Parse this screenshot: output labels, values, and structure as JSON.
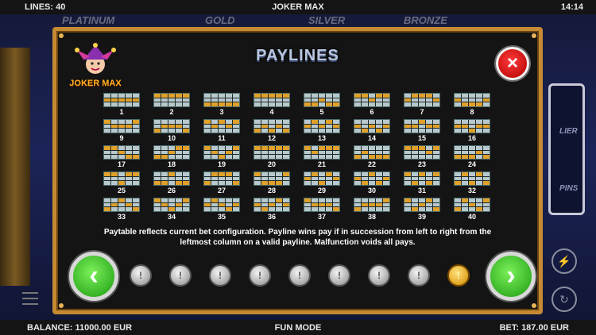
{
  "top_bar": {
    "lines": "LINES: 40",
    "title": "JOKER MAX",
    "time": "14:14"
  },
  "background": {
    "tiers": [
      "PLATINUM",
      "GOLD",
      "SILVER",
      "BRONZE"
    ],
    "right_panel_words": [
      "LIER",
      "PINS"
    ]
  },
  "panel": {
    "title": "PAYLINES",
    "logo_text": "JOKER MAX",
    "close_icon": "×",
    "info_text": "Paytable reflects current bet configuration.  Payline wins pay if in succession from left to right from the leftmost column on a valid payline.  Malfunction voids all pays.",
    "nav": {
      "prev_icon": "‹",
      "next_icon": "›"
    },
    "page_indicator": {
      "total": 9,
      "active_index": 8
    },
    "paylines": [
      {
        "n": "1",
        "rows": [
          1,
          1,
          1,
          1,
          1
        ]
      },
      {
        "n": "2",
        "rows": [
          0,
          0,
          0,
          0,
          0
        ]
      },
      {
        "n": "3",
        "rows": [
          2,
          2,
          2,
          2,
          2
        ]
      },
      {
        "n": "4",
        "rows": [
          0,
          0,
          0,
          0,
          0
        ]
      },
      {
        "n": "5",
        "rows": [
          2,
          2,
          1,
          2,
          2
        ]
      },
      {
        "n": "6",
        "rows": [
          0,
          0,
          1,
          0,
          0
        ]
      },
      {
        "n": "7",
        "rows": [
          1,
          0,
          0,
          0,
          1
        ]
      },
      {
        "n": "8",
        "rows": [
          1,
          2,
          2,
          2,
          1
        ]
      },
      {
        "n": "9",
        "rows": [
          0,
          1,
          1,
          1,
          0
        ]
      },
      {
        "n": "10",
        "rows": [
          2,
          1,
          1,
          1,
          2
        ]
      },
      {
        "n": "11",
        "rows": [
          0,
          1,
          0,
          1,
          0
        ]
      },
      {
        "n": "12",
        "rows": [
          2,
          1,
          2,
          1,
          2
        ]
      },
      {
        "n": "13",
        "rows": [
          1,
          0,
          1,
          0,
          1
        ]
      },
      {
        "n": "14",
        "rows": [
          1,
          2,
          1,
          2,
          1
        ]
      },
      {
        "n": "15",
        "rows": [
          1,
          1,
          0,
          1,
          1
        ]
      },
      {
        "n": "16",
        "rows": [
          1,
          1,
          2,
          1,
          1
        ]
      },
      {
        "n": "17",
        "rows": [
          0,
          0,
          1,
          2,
          2
        ]
      },
      {
        "n": "18",
        "rows": [
          2,
          2,
          1,
          0,
          0
        ]
      },
      {
        "n": "19",
        "rows": [
          0,
          1,
          2,
          1,
          0
        ]
      },
      {
        "n": "20",
        "rows": [
          0,
          0,
          0,
          0,
          0
        ]
      },
      {
        "n": "21",
        "rows": [
          0,
          1,
          0,
          0,
          0
        ]
      },
      {
        "n": "22",
        "rows": [
          2,
          1,
          2,
          2,
          2
        ]
      },
      {
        "n": "23",
        "rows": [
          0,
          0,
          0,
          1,
          0
        ]
      },
      {
        "n": "24",
        "rows": [
          2,
          2,
          2,
          1,
          2
        ]
      },
      {
        "n": "25",
        "rows": [
          0,
          0,
          2,
          0,
          0
        ]
      },
      {
        "n": "26",
        "rows": [
          2,
          2,
          0,
          2,
          2
        ]
      },
      {
        "n": "27",
        "rows": [
          2,
          0,
          0,
          0,
          2
        ]
      },
      {
        "n": "28",
        "rows": [
          0,
          2,
          2,
          2,
          0
        ]
      },
      {
        "n": "29",
        "rows": [
          1,
          0,
          2,
          0,
          1
        ]
      },
      {
        "n": "30",
        "rows": [
          1,
          2,
          0,
          2,
          1
        ]
      },
      {
        "n": "31",
        "rows": [
          0,
          2,
          0,
          2,
          0
        ]
      },
      {
        "n": "32",
        "rows": [
          2,
          0,
          2,
          0,
          2
        ]
      },
      {
        "n": "33",
        "rows": [
          2,
          1,
          0,
          1,
          2
        ]
      },
      {
        "n": "34",
        "rows": [
          0,
          1,
          2,
          1,
          0
        ]
      },
      {
        "n": "35",
        "rows": [
          1,
          0,
          1,
          2,
          1
        ]
      },
      {
        "n": "36",
        "rows": [
          1,
          2,
          1,
          0,
          1
        ]
      },
      {
        "n": "37",
        "rows": [
          0,
          1,
          1,
          1,
          2
        ]
      },
      {
        "n": "38",
        "rows": [
          2,
          1,
          1,
          1,
          0
        ]
      },
      {
        "n": "39",
        "rows": [
          0,
          2,
          1,
          0,
          2
        ]
      },
      {
        "n": "40",
        "rows": [
          2,
          0,
          1,
          2,
          0
        ]
      }
    ]
  },
  "bottom_bar": {
    "balance": "BALANCE: 11000.00 EUR",
    "mode": "FUN MODE",
    "bet": "BET: 187.00 EUR"
  },
  "colors": {
    "frame": "#c58a32",
    "line_on": "#e0a02a",
    "close": "#d40000",
    "arrow": "#2fbf1e"
  }
}
